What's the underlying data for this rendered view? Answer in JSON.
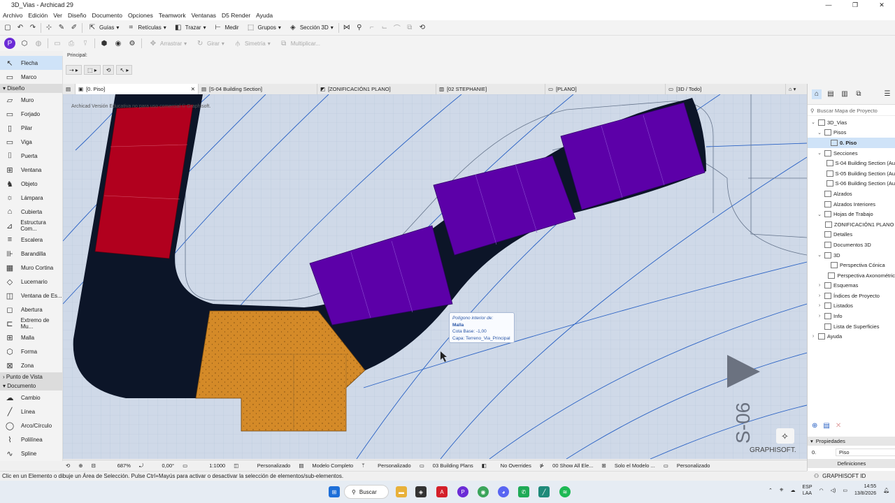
{
  "window": {
    "title": "3D_Vias - Archicad 29",
    "controls": [
      "—",
      "❐",
      "✕"
    ]
  },
  "menu": [
    "Archivo",
    "Edición",
    "Ver",
    "Diseño",
    "Documento",
    "Opciones",
    "Teamwork",
    "Ventanas",
    "D5 Render",
    "Ayuda"
  ],
  "toolbar": {
    "guias": "Guías",
    "reticulas": "Retículas",
    "trazar": "Trazar",
    "medir": "Medir",
    "grupos": "Grupos",
    "seccion3d": "Sección 3D",
    "arrastrar": "Arrastrar",
    "girar": "Girar",
    "simetria": "Simetría",
    "multiplicar": "Multiplicar..."
  },
  "infobox": {
    "label": "Principal:"
  },
  "toolbox": {
    "select_tools": [
      {
        "label": "Flecha",
        "icon": "arrow-icon",
        "glyph": "↖"
      },
      {
        "label": "Marco",
        "icon": "marquee-icon",
        "glyph": "▭"
      }
    ],
    "section_design": "Diseño",
    "design_tools": [
      {
        "label": "Muro",
        "glyph": "▱"
      },
      {
        "label": "Forjado",
        "glyph": "▭"
      },
      {
        "label": "Pilar",
        "glyph": "▯"
      },
      {
        "label": "Viga",
        "glyph": "▭"
      },
      {
        "label": "Puerta",
        "glyph": "⌷"
      },
      {
        "label": "Ventana",
        "glyph": "⊞"
      },
      {
        "label": "Objeto",
        "glyph": "♞"
      },
      {
        "label": "Lámpara",
        "glyph": "☼"
      },
      {
        "label": "Cubierta",
        "glyph": "⌂"
      },
      {
        "label": "Estructura Com...",
        "glyph": "⊿"
      },
      {
        "label": "Escalera",
        "glyph": "≡"
      },
      {
        "label": "Barandilla",
        "glyph": "⊪"
      },
      {
        "label": "Muro Cortina",
        "glyph": "▦"
      },
      {
        "label": "Lucernario",
        "glyph": "◇"
      },
      {
        "label": "Ventana de Es...",
        "glyph": "◫"
      },
      {
        "label": "Abertura",
        "glyph": "◻"
      },
      {
        "label": "Extremo de Mu...",
        "glyph": "⊏"
      },
      {
        "label": "Malla",
        "glyph": "⊞"
      },
      {
        "label": "Forma",
        "glyph": "⬡"
      },
      {
        "label": "Zona",
        "glyph": "⊠"
      }
    ],
    "section_viewpoint": "Punto de Vista",
    "section_document": "Documento",
    "document_tools": [
      {
        "label": "Cambio",
        "glyph": "☁"
      },
      {
        "label": "Línea",
        "glyph": "╱"
      },
      {
        "label": "Arco/Círculo",
        "glyph": "◯"
      },
      {
        "label": "Polilínea",
        "glyph": "⌇"
      },
      {
        "label": "Spline",
        "glyph": "∿"
      }
    ]
  },
  "tabs": [
    {
      "label": "[0. Piso]",
      "active": true
    },
    {
      "label": "[S-04 Building Section]",
      "active": false
    },
    {
      "label": "[ZONIFICACIÓN1 PLANO]",
      "active": false
    },
    {
      "label": "[02 STEPHANIE]",
      "active": false
    },
    {
      "label": "[PLANO]",
      "active": false
    },
    {
      "label": "[3D / Todo]",
      "active": false
    }
  ],
  "canvas": {
    "version_text": "Archicad Versión Educativa no para uso comercial © Graphisoft.",
    "section_marker": "S-06",
    "watermark": "GRAPHISOFT.",
    "tooltip": {
      "line1": "Polígono interior de:",
      "line2": "Malla",
      "line3": "Cota Base: -1,00",
      "line4": "Capa: Terreno_Via_Principal"
    }
  },
  "statusbar": {
    "zoom": "687%",
    "angle": "0,00°",
    "scale": "1:1000",
    "layer_combo": "Personalizado",
    "model_view": "Modelo Completo",
    "pen_set": "Personalizado",
    "plans": "03 Building Plans",
    "overrides": "No Overrides",
    "renovation": "00 Show All Ele...",
    "structural": "Solo el Modelo ...",
    "dimension": "Personalizado"
  },
  "hint": "Clic en un Elemento o dibuje un Área de Selección. Pulse Ctrl+Mayús para activar o desactivar la selección de elementos/sub-elementos.",
  "navigator": {
    "search_placeholder": "Buscar Mapa de Proyecto",
    "tree": [
      {
        "label": "3D_Vias",
        "level": 0,
        "exp": "⌄"
      },
      {
        "label": "Pisos",
        "level": 1,
        "exp": "⌄"
      },
      {
        "label": "0. Piso",
        "level": 2,
        "exp": "",
        "sel": true
      },
      {
        "label": "Secciones",
        "level": 1,
        "exp": "⌄"
      },
      {
        "label": "S-04 Building Section (Au",
        "level": 2,
        "exp": ""
      },
      {
        "label": "S-05 Building Section (Au",
        "level": 2,
        "exp": ""
      },
      {
        "label": "S-06 Building Section (Au",
        "level": 2,
        "exp": ""
      },
      {
        "label": "Alzados",
        "level": 1,
        "exp": ""
      },
      {
        "label": "Alzados Interiores",
        "level": 1,
        "exp": ""
      },
      {
        "label": "Hojas de Trabajo",
        "level": 1,
        "exp": "⌄"
      },
      {
        "label": "ZONIFICACIÓN1 PLANO (",
        "level": 2,
        "exp": ""
      },
      {
        "label": "Detalles",
        "level": 1,
        "exp": ""
      },
      {
        "label": "Documentos 3D",
        "level": 1,
        "exp": ""
      },
      {
        "label": "3D",
        "level": 1,
        "exp": "⌄"
      },
      {
        "label": "Perspectiva Cónica",
        "level": 2,
        "exp": ""
      },
      {
        "label": "Perspectiva Axonométric",
        "level": 2,
        "exp": ""
      },
      {
        "label": "Esquemas",
        "level": 1,
        "exp": "›"
      },
      {
        "label": "Índices de Proyecto",
        "level": 1,
        "exp": "›"
      },
      {
        "label": "Listados",
        "level": 1,
        "exp": "›"
      },
      {
        "label": "Info",
        "level": 1,
        "exp": "›"
      },
      {
        "label": "Lista de Superficies",
        "level": 1,
        "exp": ""
      },
      {
        "label": "Ayuda",
        "level": 0,
        "exp": "›"
      }
    ],
    "properties_title": "Propiedades",
    "prop_id": "0.",
    "prop_value": "Piso",
    "definitions_btn": "Definiciones",
    "graphisoft_id": "GRAPHISOFT ID"
  },
  "taskbar": {
    "search": "Buscar",
    "lang1": "ESP",
    "lang2": "LAA",
    "time": "14:55",
    "date": "13/8/2026"
  },
  "colors": {
    "canvas_bg": "#cfd9e8",
    "road": "#0c1528",
    "red_block": "#b1001e",
    "purple_block": "#5c00a8",
    "orange_block": "#d48a28",
    "blue_lines": "#2a62c4"
  }
}
